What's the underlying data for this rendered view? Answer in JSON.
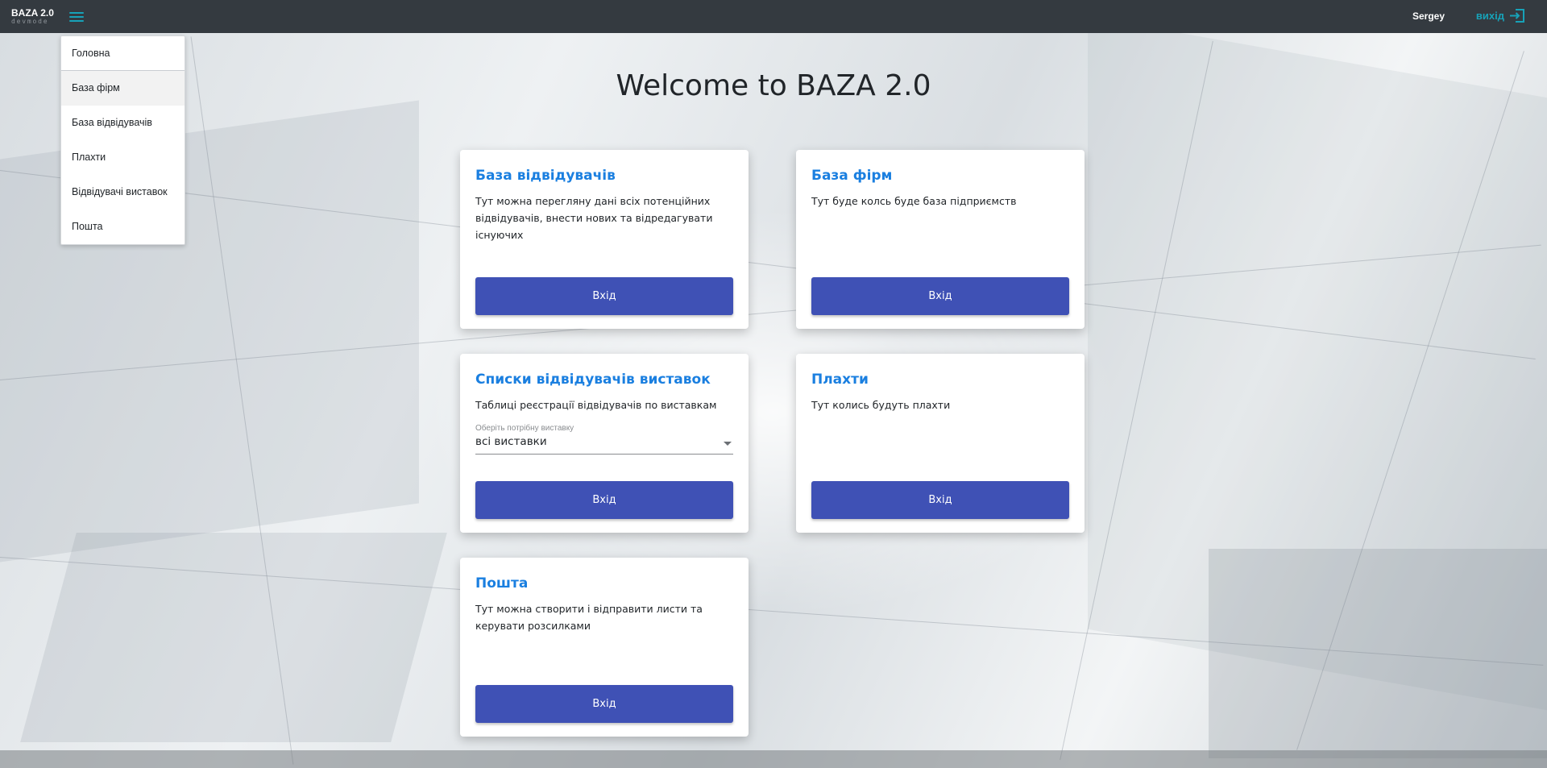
{
  "header": {
    "brand_title": "BAZA 2.0",
    "brand_subtitle": "devmode",
    "user_name": "Sergey",
    "logout_label": "вихід"
  },
  "menu": {
    "items": [
      {
        "label": "Головна"
      },
      {
        "label": "База фірм"
      },
      {
        "label": "База відвідувачів"
      },
      {
        "label": "Плахти"
      },
      {
        "label": "Відвідувачі виставок"
      },
      {
        "label": "Пошта"
      }
    ]
  },
  "main": {
    "title": "Welcome to BAZA 2.0",
    "cards": [
      {
        "title": "База відвідувачів",
        "text": "Тут можна перегляну дані всіх потенційних відвідувачів, внести нових та відредагувати існуючих",
        "button": "Вхід"
      },
      {
        "title": "База фірм",
        "text": "Тут буде колсь буде база підприємств",
        "button": "Вхід"
      },
      {
        "title": "Списки відвідувачів виставок",
        "text": "Таблиці реєстрації відвідувачів по виставкам",
        "select_label": "Оберіть потрібну виставку",
        "select_value": "всі виставки",
        "button": "Вхід"
      },
      {
        "title": "Плахти",
        "text": "Тут колись будуть плахти",
        "button": "Вхід"
      },
      {
        "title": "Пошта",
        "text": "Тут можна створити і відправити листи та керувати розсилками",
        "button": "Вхід"
      }
    ]
  },
  "colors": {
    "topbar": "#343a40",
    "accent": "#17a2b8",
    "card_title": "#1a7fe0",
    "button": "#3f51b5"
  },
  "icons": {
    "menu_toggle": "hamburger-icon",
    "logout": "logout-icon",
    "select_arrow": "caret-down-icon"
  }
}
